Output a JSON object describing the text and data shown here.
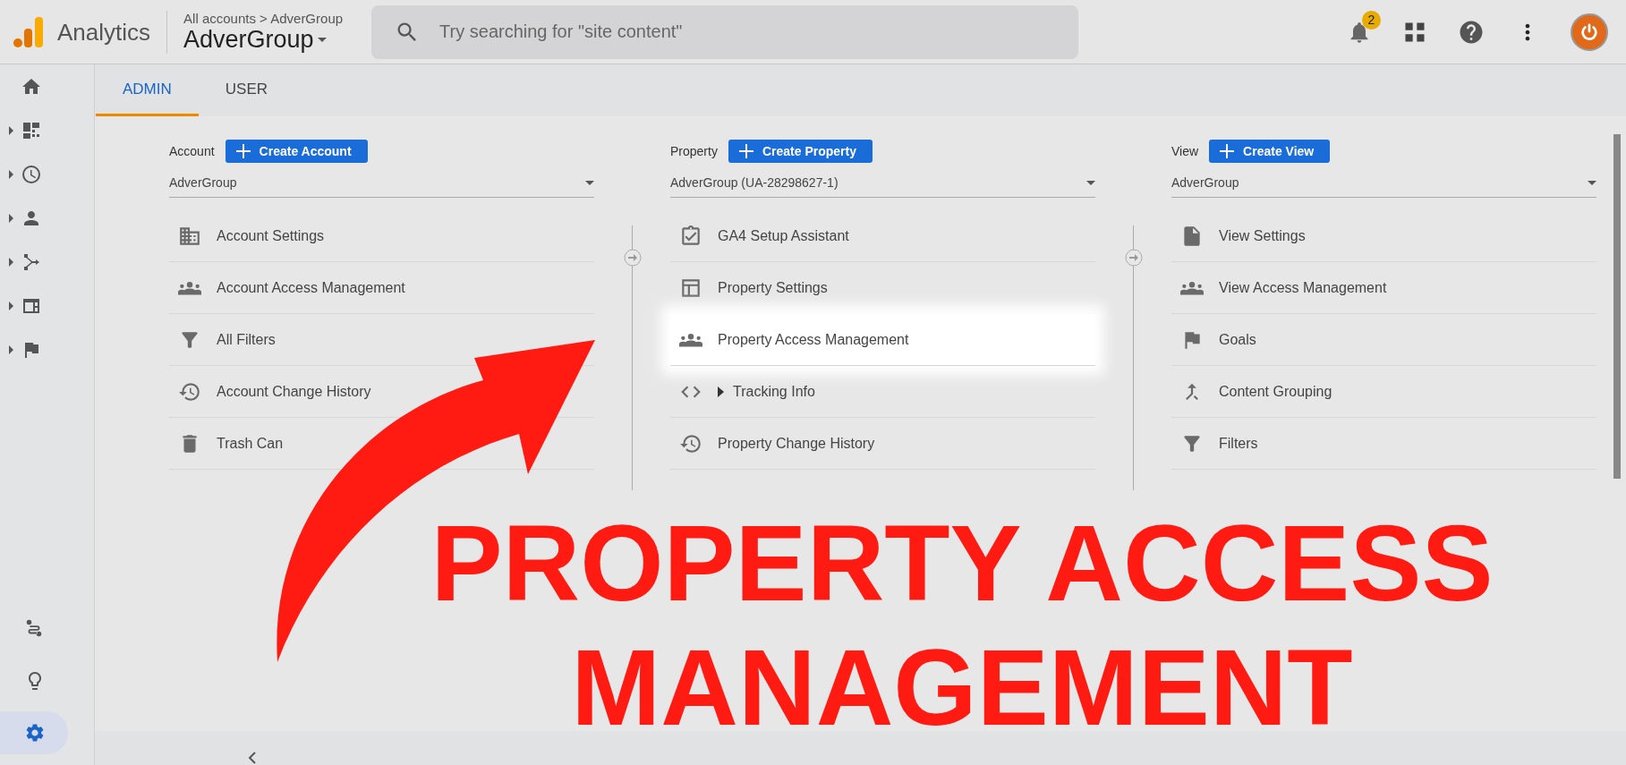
{
  "header": {
    "product": "Analytics",
    "breadcrumb": "All accounts > AdverGroup",
    "account": "AdverGroup",
    "search": {
      "placeholder": "Try searching for \"site content\""
    },
    "notifications": "2"
  },
  "tabs": [
    {
      "label": "ADMIN",
      "selected": true
    },
    {
      "label": "USER",
      "selected": false
    }
  ],
  "columns": [
    {
      "label": "Account",
      "button": "Create Account",
      "dropdown": "AdverGroup",
      "items": [
        {
          "label": "Account Settings",
          "kind": "link",
          "highlighted": false
        },
        {
          "label": "Account Access Management",
          "kind": "link",
          "highlighted": false
        },
        {
          "label": "All Filters",
          "kind": "link",
          "highlighted": false
        },
        {
          "label": "Account Change History",
          "kind": "link",
          "highlighted": false
        },
        {
          "label": "Trash Can",
          "kind": "link",
          "highlighted": false
        }
      ]
    },
    {
      "label": "Property",
      "button": "Create Property",
      "dropdown": "AdverGroup (UA-28298627-1)",
      "items": [
        {
          "label": "GA4 Setup Assistant",
          "kind": "link",
          "highlighted": false
        },
        {
          "label": "Property Settings",
          "kind": "link",
          "highlighted": false
        },
        {
          "label": "Property Access Management",
          "kind": "link",
          "highlighted": true
        },
        {
          "label": "Tracking Info",
          "kind": "expandable",
          "highlighted": false
        },
        {
          "label": "Property Change History",
          "kind": "link",
          "highlighted": false
        }
      ]
    },
    {
      "label": "View",
      "button": "Create View",
      "dropdown": "AdverGroup",
      "items": [
        {
          "label": "View Settings",
          "kind": "link",
          "highlighted": false
        },
        {
          "label": "View Access Management",
          "kind": "link",
          "highlighted": false
        },
        {
          "label": "Goals",
          "kind": "link",
          "highlighted": false
        },
        {
          "label": "Content Grouping",
          "kind": "link",
          "highlighted": false
        },
        {
          "label": "Filters",
          "kind": "link",
          "highlighted": false
        }
      ]
    }
  ],
  "annotation": {
    "text": "PROPERTY ACCESS MANAGEMENT"
  }
}
